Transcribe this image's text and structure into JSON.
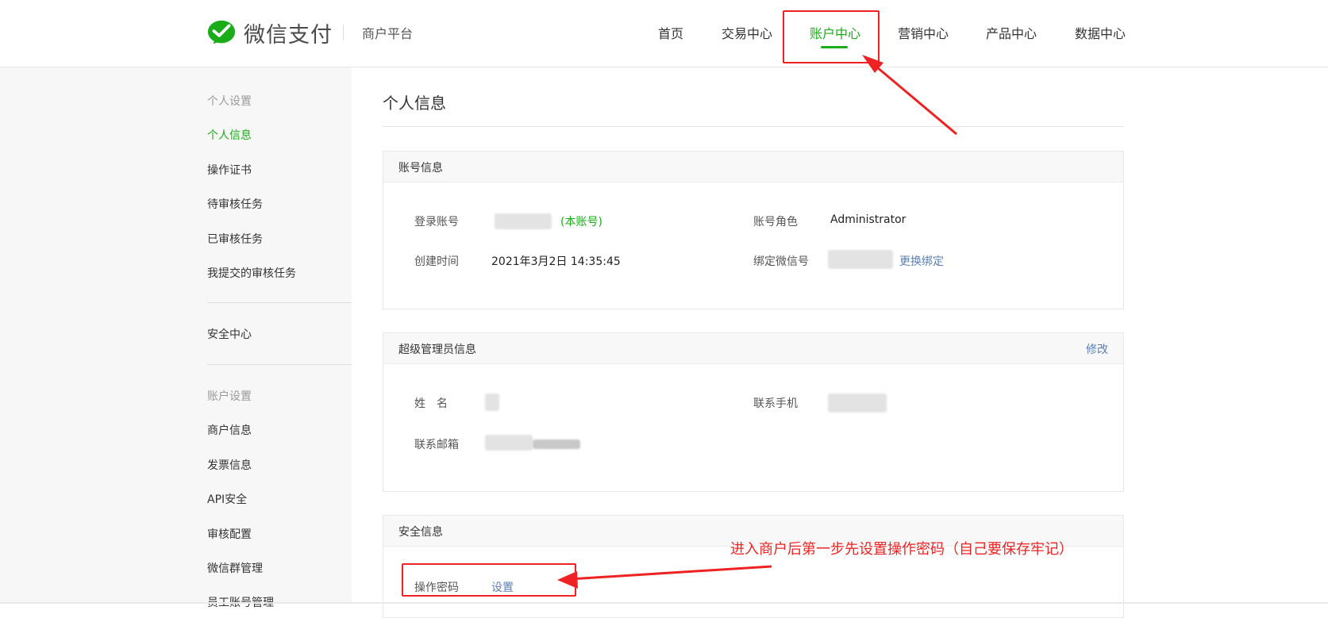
{
  "header": {
    "brand": "微信支付",
    "platform": "商户平台",
    "nav": [
      {
        "label": "首页"
      },
      {
        "label": "交易中心"
      },
      {
        "label": "账户中心"
      },
      {
        "label": "营销中心"
      },
      {
        "label": "产品中心"
      },
      {
        "label": "数据中心"
      }
    ],
    "active_nav": "账户中心"
  },
  "sidebar": {
    "group_personal": "个人设置",
    "items_personal": [
      {
        "label": "个人信息"
      },
      {
        "label": "操作证书"
      },
      {
        "label": "待审核任务"
      },
      {
        "label": "已审核任务"
      },
      {
        "label": "我提交的审核任务"
      }
    ],
    "security": "安全中心",
    "group_account": "账户设置",
    "items_account": [
      {
        "label": "商户信息"
      },
      {
        "label": "发票信息"
      },
      {
        "label": "API安全"
      },
      {
        "label": "审核配置"
      },
      {
        "label": "微信群管理"
      },
      {
        "label": "员工账号管理"
      }
    ],
    "active_item": "个人信息"
  },
  "main": {
    "title": "个人信息",
    "account_panel": {
      "title": "账号信息",
      "login_label": "登录账号",
      "login_tag": "(本账号)",
      "role_label": "账号角色",
      "role_value": "Administrator",
      "created_label": "创建时间",
      "created_value": "2021年3月2日 14:35:45",
      "wechat_label": "绑定微信号",
      "rebind_link": "更换绑定"
    },
    "admin_panel": {
      "title": "超级管理员信息",
      "edit_link": "修改",
      "name_label": "姓　名",
      "phone_label": "联系手机",
      "email_label": "联系邮箱"
    },
    "security_panel": {
      "title": "安全信息",
      "password_label": "操作密码",
      "set_link": "设置"
    }
  },
  "annotation": {
    "text": "进入商户后第一步先设置操作密码（自己要保存牢记）",
    "color": "#ee2222"
  },
  "colors": {
    "accent": "#1aad19",
    "link": "#5b7fb5",
    "annotation": "#ee2222"
  }
}
